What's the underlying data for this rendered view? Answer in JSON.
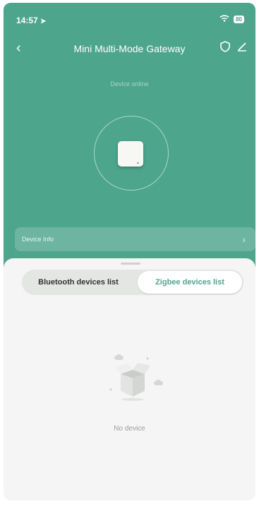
{
  "status_bar": {
    "time": "14:57",
    "battery": "80",
    "icons": [
      "location-arrow-icon",
      "wifi-icon",
      "battery-icon"
    ]
  },
  "header": {
    "title": "Mini Multi-Mode Gateway",
    "back_icon": "chevron-left-icon",
    "security_icon": "shield-icon",
    "edit_icon": "pencil-icon"
  },
  "device": {
    "status": "Device online"
  },
  "device_info": {
    "label": "Device Info",
    "chevron": "›"
  },
  "tabs": [
    {
      "label": "Bluetooth devices list",
      "selected": false
    },
    {
      "label": "Zigbee devices list",
      "selected": true
    }
  ],
  "empty_state": {
    "message": "No device",
    "icon": "empty-box-icon"
  },
  "colors": {
    "primary": "#4da58c",
    "sheet_background": "#f4f5f4",
    "tab_active_text": "#4da58c"
  }
}
